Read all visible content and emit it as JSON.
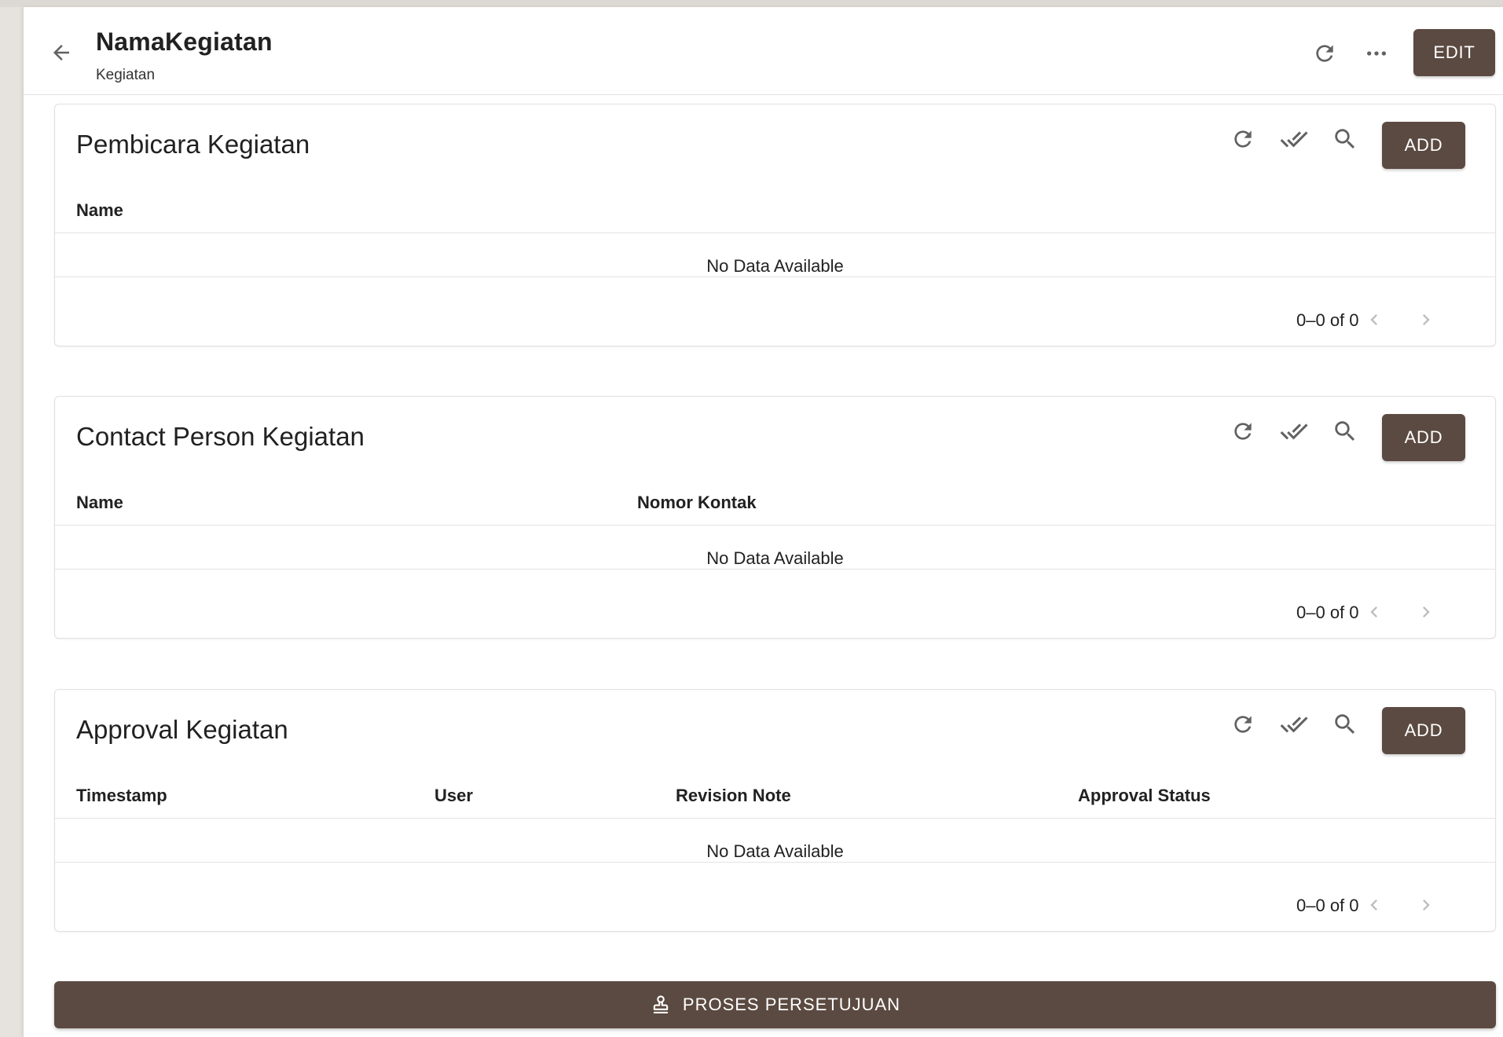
{
  "header": {
    "title": "NamaKegiatan",
    "subtitle": "Kegiatan",
    "edit_label": "EDIT",
    "icons": {
      "back": "arrow-left-icon",
      "refresh": "refresh-icon",
      "more": "more-horizontal-icon"
    }
  },
  "cards": [
    {
      "title": "Pembicara Kegiatan",
      "add_label": "ADD",
      "columns": [
        "Name"
      ],
      "empty_text": "No Data Available",
      "pagination": "0–0 of 0"
    },
    {
      "title": "Contact Person Kegiatan",
      "add_label": "ADD",
      "columns": [
        "Name",
        "Nomor Kontak"
      ],
      "empty_text": "No Data Available",
      "pagination": "0–0 of 0"
    },
    {
      "title": "Approval Kegiatan",
      "add_label": "ADD",
      "columns": [
        "Timestamp",
        "User",
        "Revision Note",
        "Approval Status"
      ],
      "empty_text": "No Data Available",
      "pagination": "0–0 of 0"
    }
  ],
  "footer": {
    "approval_label": "PROSES PERSETUJUAN",
    "approval_icon": "stamp-icon"
  },
  "colors": {
    "accent": "#5b4a41",
    "background": "#e6e2de",
    "surface": "#ffffff",
    "icon": "#616161",
    "disabled_icon": "#bdbdbd"
  }
}
